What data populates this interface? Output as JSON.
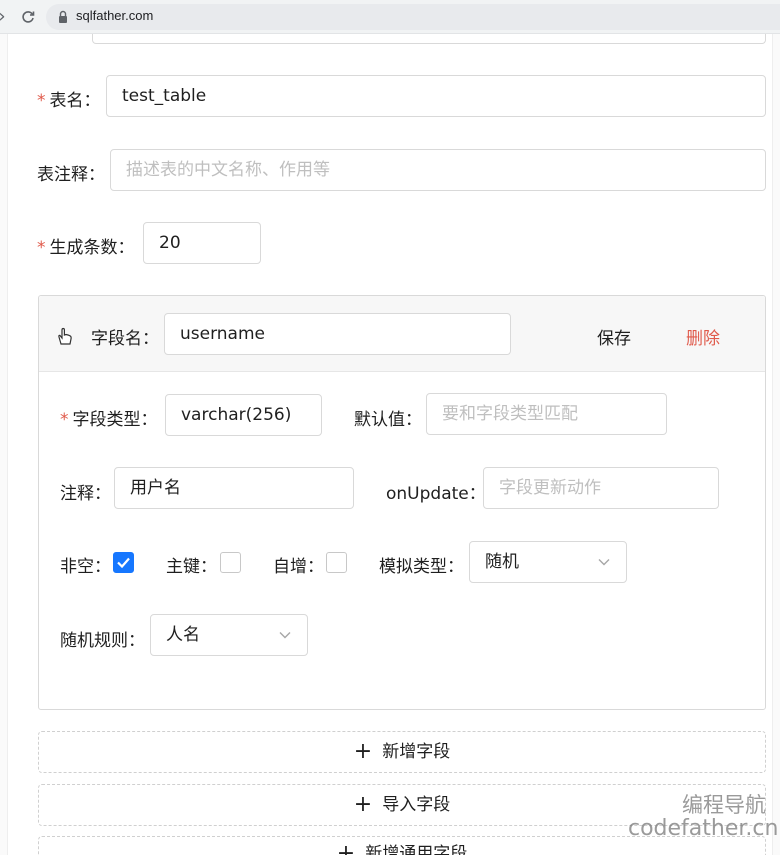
{
  "browser": {
    "url": "sqlfather.com"
  },
  "form": {
    "table_name": {
      "label": "表名：",
      "value": "test_table"
    },
    "table_comment": {
      "label": "表注释：",
      "placeholder": "描述表的中文名称、作用等"
    },
    "mock_count": {
      "label": "生成条数：",
      "value": "20"
    }
  },
  "field": {
    "name_label": "字段名：",
    "name_value": "username",
    "save_label": "保存",
    "delete_label": "删除",
    "type_label": "字段类型：",
    "type_value": "varchar(256)",
    "default_label": "默认值：",
    "default_placeholder": "要和字段类型匹配",
    "comment_label": "注释：",
    "comment_value": "用户名",
    "onupdate_label": "onUpdate：",
    "onupdate_placeholder": "字段更新动作",
    "not_null_label": "非空：",
    "not_null_checked": true,
    "primary_key_label": "主键：",
    "primary_key_checked": false,
    "auto_increment_label": "自增：",
    "auto_increment_checked": false,
    "mock_type_label": "模拟类型：",
    "mock_type_value": "随机",
    "random_rule_label": "随机规则：",
    "random_rule_value": "人名"
  },
  "actions": {
    "add_field": "新增字段",
    "import_field": "导入字段",
    "add_common_field": "新增通用字段"
  },
  "watermark": {
    "line1": "编程导航",
    "line2": "codefather.cn"
  },
  "colors": {
    "required": "#e05a4b",
    "delete": "#e05a4b",
    "checkbox": "#1677ff"
  }
}
